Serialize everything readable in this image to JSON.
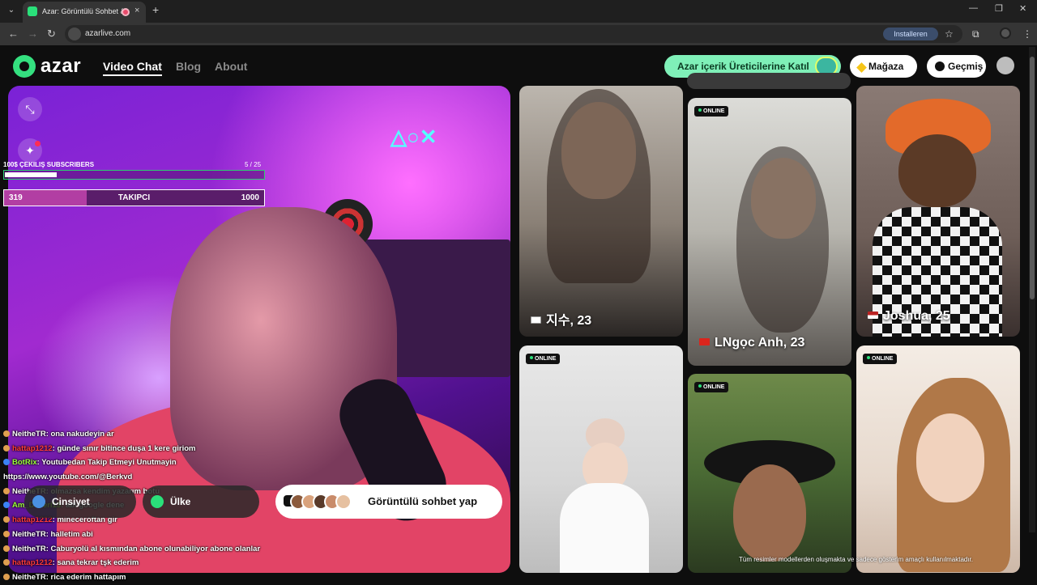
{
  "browser": {
    "tab_title": "Azar: Görüntülü Sohbet & V",
    "tab_close": "×",
    "new_tab": "+",
    "url": "azarlive.com",
    "install_label": "Installeren",
    "window_controls": [
      "—",
      "❐",
      "✕"
    ]
  },
  "header": {
    "logo_text": "azar",
    "nav": [
      "Video Chat",
      "Blog",
      "About"
    ],
    "creator_label": "Azar içerik Üreticilerine Katıl",
    "store_label": "Mağaza",
    "history_label": "Geçmiş"
  },
  "overlay": {
    "giveaway_label": "100$ ÇEKILIŞ SUBSCRIBERS",
    "giveaway_count": "5  / 25",
    "giveaway_progress": 0.2,
    "follower_min": "319",
    "follower_title": "TAKIPCI",
    "follower_max": "1000",
    "follower_progress": 0.319
  },
  "chat": [
    {
      "user": "NeitheTR",
      "color": "white",
      "text": ": ona nakudeyin ar"
    },
    {
      "user": "hattap1212",
      "color": "red",
      "text": ": günde sınır bitince duşa 1 kere giriom"
    },
    {
      "user": "BotRix",
      "color": "green",
      "text": ": Youtubedan Takip Etmeyi Unutmayin"
    },
    {
      "user": "",
      "color": "white",
      "text": "https://www.youtube.com/@Berkvd"
    },
    {
      "user": "NeitheTR",
      "color": "white",
      "text": ": olmazsa kendim yazarım botu"
    },
    {
      "user": "Am_Dozeri13",
      "color": "green",
      "text": ": abi google dene"
    },
    {
      "user": "hattap1212",
      "color": "red",
      "text": ": mineceroftan gir"
    },
    {
      "user": "NeitheTR",
      "color": "white",
      "text": ": halletim abi"
    },
    {
      "user": "NeitheTR",
      "color": "white",
      "text": ": Caburyolü al kısmından abone olunabiliyor abone olanlar"
    },
    {
      "user": "hattap1212",
      "color": "red",
      "text": ": sana tekrar tşk ederim"
    },
    {
      "user": "NeitheTR",
      "color": "white",
      "text": ": rica ederim hattapım"
    }
  ],
  "controls": {
    "gender_label": "Cinsiyet",
    "region_label": "Ülke",
    "start_label": "Görüntülü sohbet yap"
  },
  "cards": [
    {
      "name": "지수, 23",
      "online": "ONLINE",
      "flag": "kr"
    },
    {
      "name": "LNgọc Anh, 23",
      "online": "ONLINE",
      "flag": "vn"
    },
    {
      "name": "Joshua, 25",
      "online": "ONLINE",
      "flag": "us"
    },
    {
      "name": "",
      "online": "ONLINE",
      "flag": ""
    },
    {
      "name": "",
      "online": "ONLINE",
      "flag": ""
    },
    {
      "name": "",
      "online": "ONLINE",
      "flag": ""
    }
  ],
  "disclaimer": "Tüm resimler modellerden oluşmakta ve sadece gösterim amaçlı kullanılmaktadır.",
  "colors": {
    "brand_green": "#34e07f",
    "online_dot": "#2ae07a",
    "creator_bg": "#7ff0b8"
  }
}
